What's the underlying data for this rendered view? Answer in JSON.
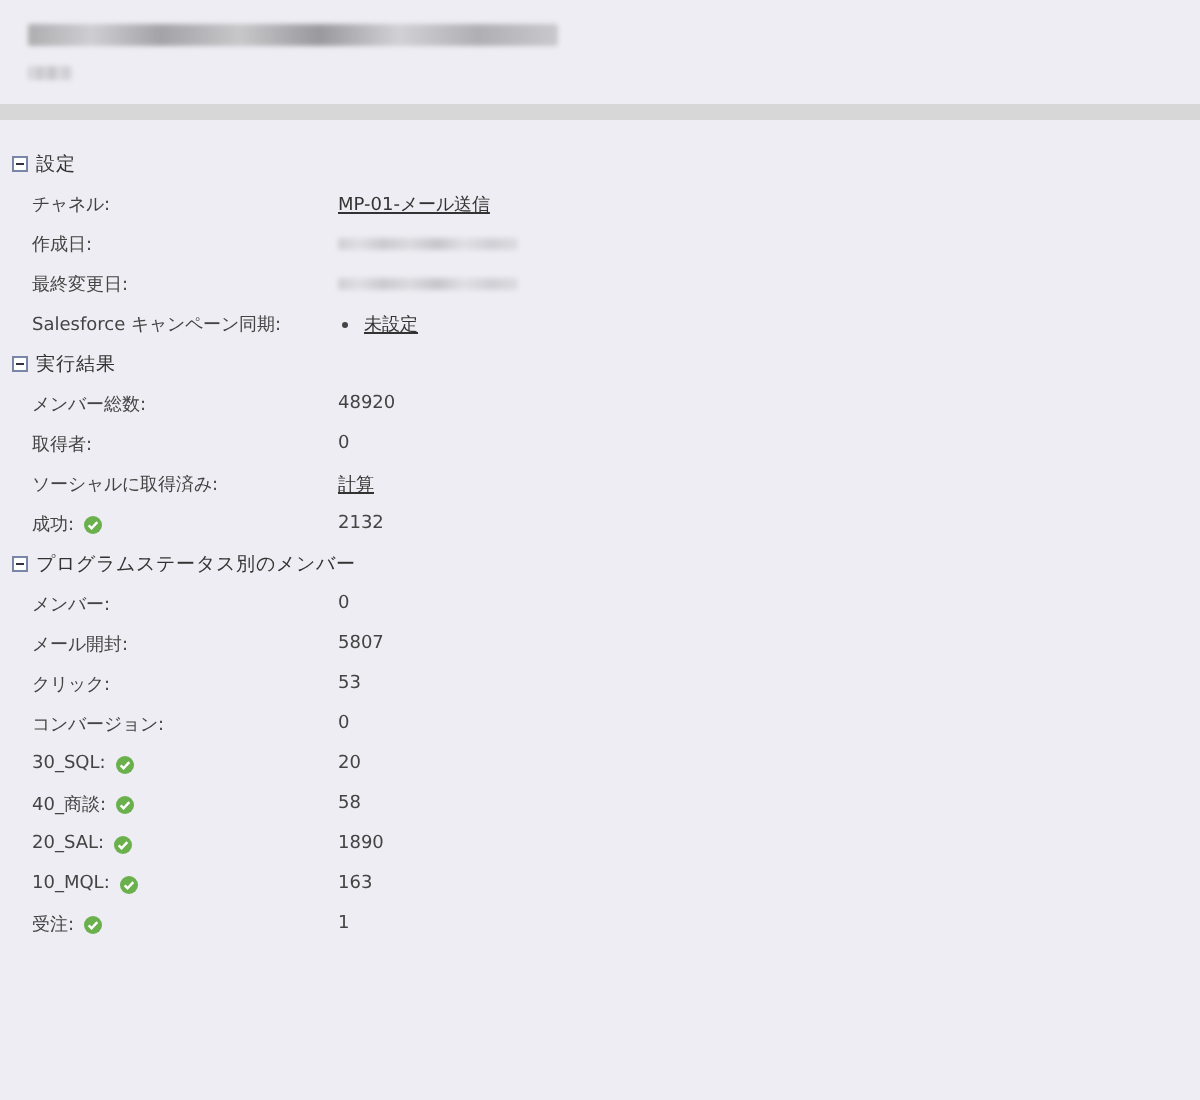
{
  "header": {
    "title": {
      "kind": "redacted"
    },
    "subtitle": {
      "kind": "redacted"
    }
  },
  "sections": [
    {
      "title": "設定",
      "expanded": true,
      "rows": [
        {
          "label": "チャネル:",
          "kind": "link",
          "value": "MP-01-メール送信"
        },
        {
          "label": "作成日:",
          "kind": "redacted"
        },
        {
          "label": "最終変更日:",
          "kind": "redacted"
        },
        {
          "label": "Salesforce キャンペーン同期:",
          "kind": "bullet-link",
          "value": "未設定"
        }
      ]
    },
    {
      "title": "実行結果",
      "expanded": true,
      "rows": [
        {
          "label": "メンバー総数:",
          "kind": "text",
          "value": "48920"
        },
        {
          "label": "取得者:",
          "kind": "text",
          "value": "0"
        },
        {
          "label": "ソーシャルに取得済み:",
          "kind": "link",
          "value": "計算"
        },
        {
          "label": "成功:",
          "kind": "text",
          "value": "2132",
          "success": true
        }
      ]
    },
    {
      "title": "プログラムステータス別のメンバー",
      "expanded": true,
      "rows": [
        {
          "label": "メンバー:",
          "kind": "text",
          "value": "0"
        },
        {
          "label": "メール開封:",
          "kind": "text",
          "value": "5807"
        },
        {
          "label": "クリック:",
          "kind": "text",
          "value": "53"
        },
        {
          "label": "コンバージョン:",
          "kind": "text",
          "value": "0"
        },
        {
          "label": "30_SQL:",
          "kind": "text",
          "value": "20",
          "success": true
        },
        {
          "label": "40_商談:",
          "kind": "text",
          "value": "58",
          "success": true
        },
        {
          "label": "20_SAL:",
          "kind": "text",
          "value": "1890",
          "success": true
        },
        {
          "label": "10_MQL:",
          "kind": "text",
          "value": "163",
          "success": true
        },
        {
          "label": "受注:",
          "kind": "text",
          "value": "1",
          "success": true
        }
      ]
    }
  ]
}
